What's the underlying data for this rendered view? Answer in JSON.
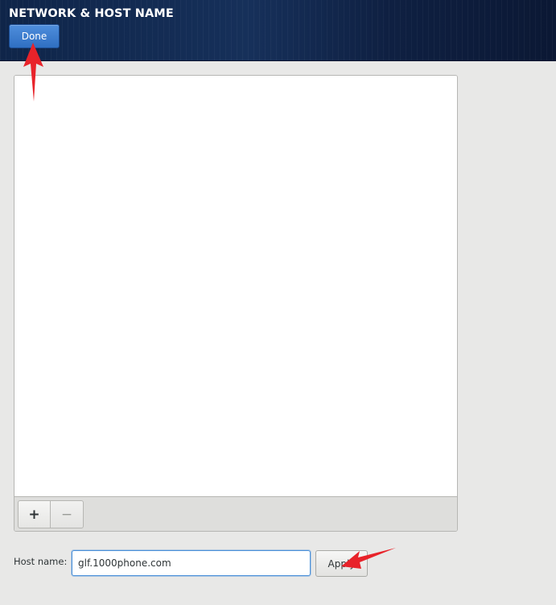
{
  "header": {
    "title": "NETWORK & HOST NAME",
    "done_label": "Done"
  },
  "device_panel": {
    "add_label": "+",
    "remove_label": "−"
  },
  "hostname": {
    "label": "Host name:",
    "value": "glf.1000phone.com",
    "apply_label": "Apply"
  },
  "colors": {
    "header_bg": "#13294f",
    "done_button": "#3b7bd0",
    "focus_border": "#4a90d9",
    "annotation_arrow": "#e8232a"
  },
  "icons": {
    "add": "plus-icon",
    "remove": "minus-icon",
    "annotation": "red-arrow-icon"
  }
}
